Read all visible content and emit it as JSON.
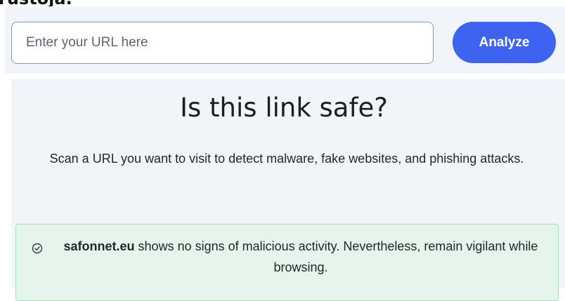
{
  "page": {
    "cut_heading": "rustoja."
  },
  "search": {
    "placeholder": "Enter your URL here",
    "value": "",
    "button_label": "Analyze"
  },
  "hero": {
    "title": "Is this link safe?",
    "subtitle": "Scan a URL you want to visit to detect malware, fake websites, and phishing attacks."
  },
  "result": {
    "icon": "check-circle-icon",
    "domain": "safonnet.eu",
    "message": " shows no signs of malicious activity. Nevertheless, remain vigilant while browsing."
  },
  "colors": {
    "accent": "#3e63f0",
    "panel_background": "#f1f4f8",
    "success_background": "#e6f5ec",
    "success_border": "#a9dcbd"
  }
}
